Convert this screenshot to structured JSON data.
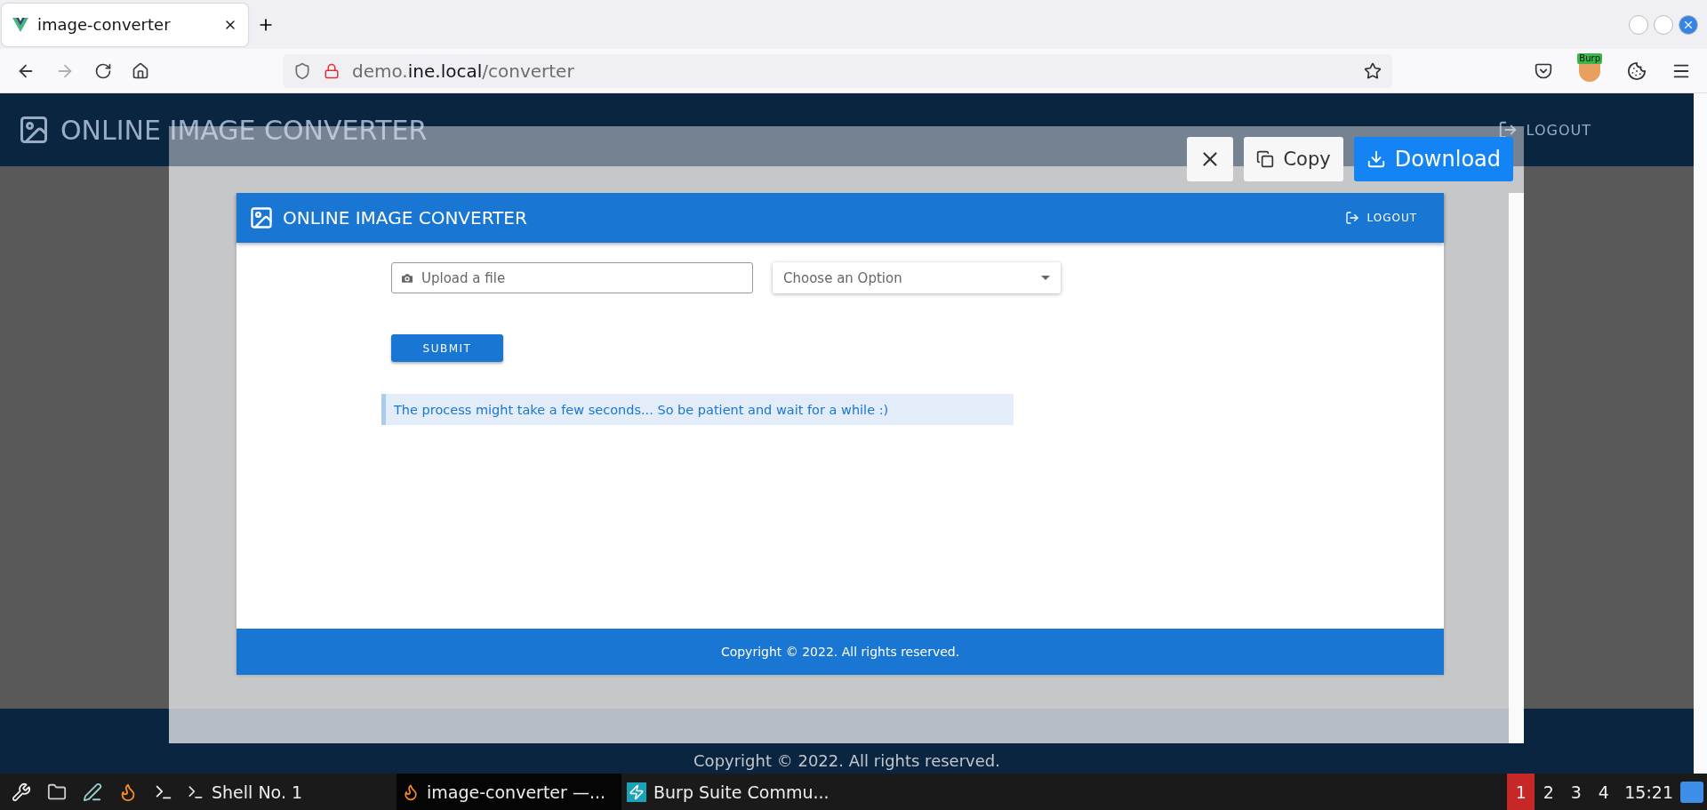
{
  "browser": {
    "tab": {
      "title": "image-converter",
      "selected": true
    },
    "navigation": {
      "back": {
        "disabled": false
      },
      "forward": {
        "disabled": true
      }
    },
    "url": "demo.**ine.local**/converter",
    "extension_badge": "Burp"
  },
  "page": {
    "title": "ONLINE IMAGE CONVERTER",
    "logout": "LOGOUT",
    "footer": "Copyright © 2022. All rights reserved."
  },
  "preview_dialog": {
    "actions": [
      {
        "kind": "close"
      },
      {
        "kind": "copy",
        "label": "Copy"
      },
      {
        "kind": "download",
        "label": "Download"
      }
    ],
    "app": {
      "title": "ONLINE IMAGE CONVERTER",
      "logout": "LOGOUT",
      "upload": {
        "placeholder": "Upload a file"
      },
      "select": {
        "placeholder": "Choose an Option"
      },
      "submit": "SUBMIT",
      "notice": "The process might take a few seconds... So be patient and wait for a while :)",
      "footer": "Copyright © 2022. All rights reserved."
    }
  },
  "taskbar": {
    "windows": [
      {
        "label": "Shell No. 1",
        "kind": "terminal",
        "selected": false
      },
      {
        "label": "image-converter —...",
        "kind": "browser",
        "selected": true
      },
      {
        "label": "Burp Suite Commu...",
        "kind": "burp",
        "selected": false
      }
    ],
    "workspaces": [
      {
        "label": "1",
        "selected": true
      },
      {
        "label": "2",
        "selected": false
      },
      {
        "label": "3",
        "selected": false
      },
      {
        "label": "4",
        "selected": false
      }
    ],
    "clock": "15:21"
  }
}
